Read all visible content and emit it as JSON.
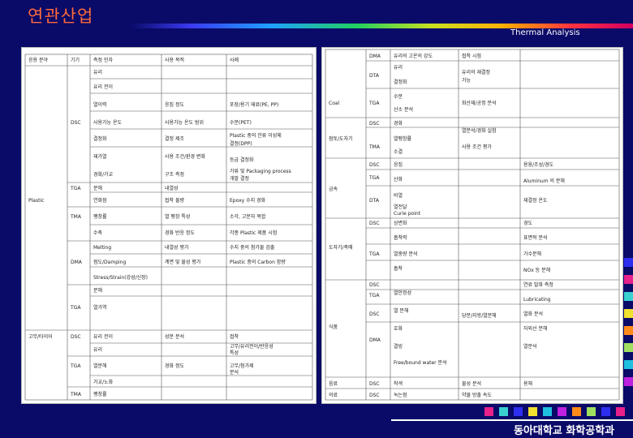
{
  "header": {
    "title": "연관산업",
    "subtitle": "Thermal Analysis"
  },
  "left_table": {
    "headers": [
      "응용 분야",
      "기기",
      "측정 인자",
      "사용 목적",
      "사례"
    ],
    "cells": [
      "유리",
      "유리 전이",
      "열이력",
      "응집 정도",
      "포장/용기 재료(PE, PP)",
      "DSC",
      "사용가능 온도",
      "사용가능 온도 범위",
      "수분(PET)",
      "결정화",
      "결정 제조",
      "Plastic 중의 잔류 이성체",
      "결정(DPP)",
      "재가열",
      "사용 조건/환경 변화",
      "등급 결정화",
      "경화/가교",
      "구조 측정",
      "가류 및 Packaging process",
      "개발 결정",
      "TGA",
      "분해",
      "내열성",
      "Plastic",
      "TMA",
      "연화점",
      "접착 불량",
      "Epoxy 수지 경화",
      "팽창률",
      "열 팽창 특성",
      "소각, 고분자 복합",
      "수축",
      "경화 반응 정도",
      "각종 Plastic 제품 시험",
      "Melting",
      "내열성 평가",
      "수지 중의 첨가물 검출",
      "DMA",
      "점도/Damping",
      "계면 및 물성 평가",
      "Plastic 중의 Carbon 함량",
      "Stress/Strain(강성/신장)",
      "분해",
      "TGA",
      "열가역",
      "고무/타이어",
      "DSC",
      "유리 전이",
      "성분 분석",
      "접착",
      "유리",
      "고무/유리전이/반응성",
      "특성",
      "TGA",
      "열분해",
      "경화 정도",
      "고무/첨가제",
      "분석",
      "가교/노화",
      "TMA",
      "팽창률"
    ]
  },
  "right_table": {
    "cells": [
      "DMA",
      "유리의 고온의 강도",
      "접착 시험",
      "DTA",
      "유리",
      "유리의 재결정",
      "가능",
      "결정화",
      "Coal",
      "TGA",
      "수분",
      "산소 분석",
      "화산재/공정 분석",
      "DSC",
      "경화",
      "점토/도자기",
      "열팽창률",
      "열분석/경화 실험",
      "TMA",
      "소결",
      "사용 조건 평가",
      "DSC",
      "응집",
      "용융/조성/경도",
      "산화",
      "금속",
      "TGA",
      "비열",
      "Aluminum 의 분해",
      "DTA",
      "열전달",
      "Curie point",
      "재결정 온도",
      "DSC",
      "상변화",
      "경도",
      "도자기/촉매",
      "TGA",
      "흡착력",
      "표면적 분석",
      "가수분해",
      "열중량 분석",
      "흡착",
      "NOx 등 분해",
      "DSC",
      "열안정성",
      "연료 발화 측정",
      "Lubricating",
      "TGA",
      "열 분해",
      "식품",
      "당분/지방/열분해",
      "열화 분석",
      "DSC",
      "호화",
      "자외선 분해",
      "DMA",
      "결빙",
      "Free/bound water 분석",
      "열분석",
      "음료",
      "DSC",
      "착색",
      "물성 분석",
      "용해",
      "의료",
      "DSC",
      "녹는점",
      "약물 방출 속도"
    ]
  },
  "colors": {
    "background": "#0a0a68",
    "title": "#ff6a3a",
    "squares": [
      "#1a1ad0",
      "#e8208a",
      "#3ad0d0",
      "#f0e030",
      "#ff8a1a",
      "#a0e060",
      "#20c0e0",
      "#c020e0"
    ]
  },
  "footer": {
    "label": "동아대학교 화학공학과"
  }
}
